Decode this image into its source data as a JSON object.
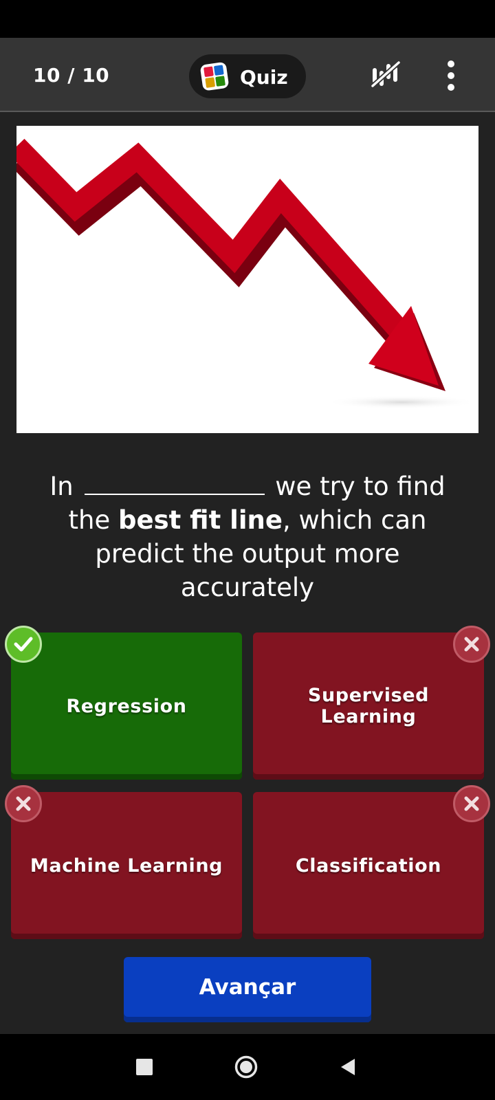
{
  "header": {
    "counter": "10 / 10",
    "title": "Quiz"
  },
  "question": {
    "image_icon": "downward-trend-arrow",
    "prefix": "In",
    "middle_before": "we try to find the",
    "emphasis": "best fit line",
    "suffix": ", which can predict the output more accurately"
  },
  "options": [
    {
      "label": "Regression",
      "status": "correct"
    },
    {
      "label": "Supervised Learning",
      "status": "wrong"
    },
    {
      "label": "Machine Learning",
      "status": "wrong"
    },
    {
      "label": "Classification",
      "status": "wrong"
    }
  ],
  "advance_label": "Avançar",
  "colors": {
    "background": "#222222",
    "topbar": "#353535",
    "correct": "#176b08",
    "wrong": "#821421",
    "button": "#0a3fc0",
    "arrow": "#c8001a"
  },
  "icons": {
    "header": [
      "quiz-logo-icon",
      "stats-icon",
      "more-vert-icon"
    ],
    "options": [
      "check-icon",
      "close-icon"
    ],
    "nav": [
      "recents-icon",
      "home-icon",
      "back-icon"
    ]
  }
}
